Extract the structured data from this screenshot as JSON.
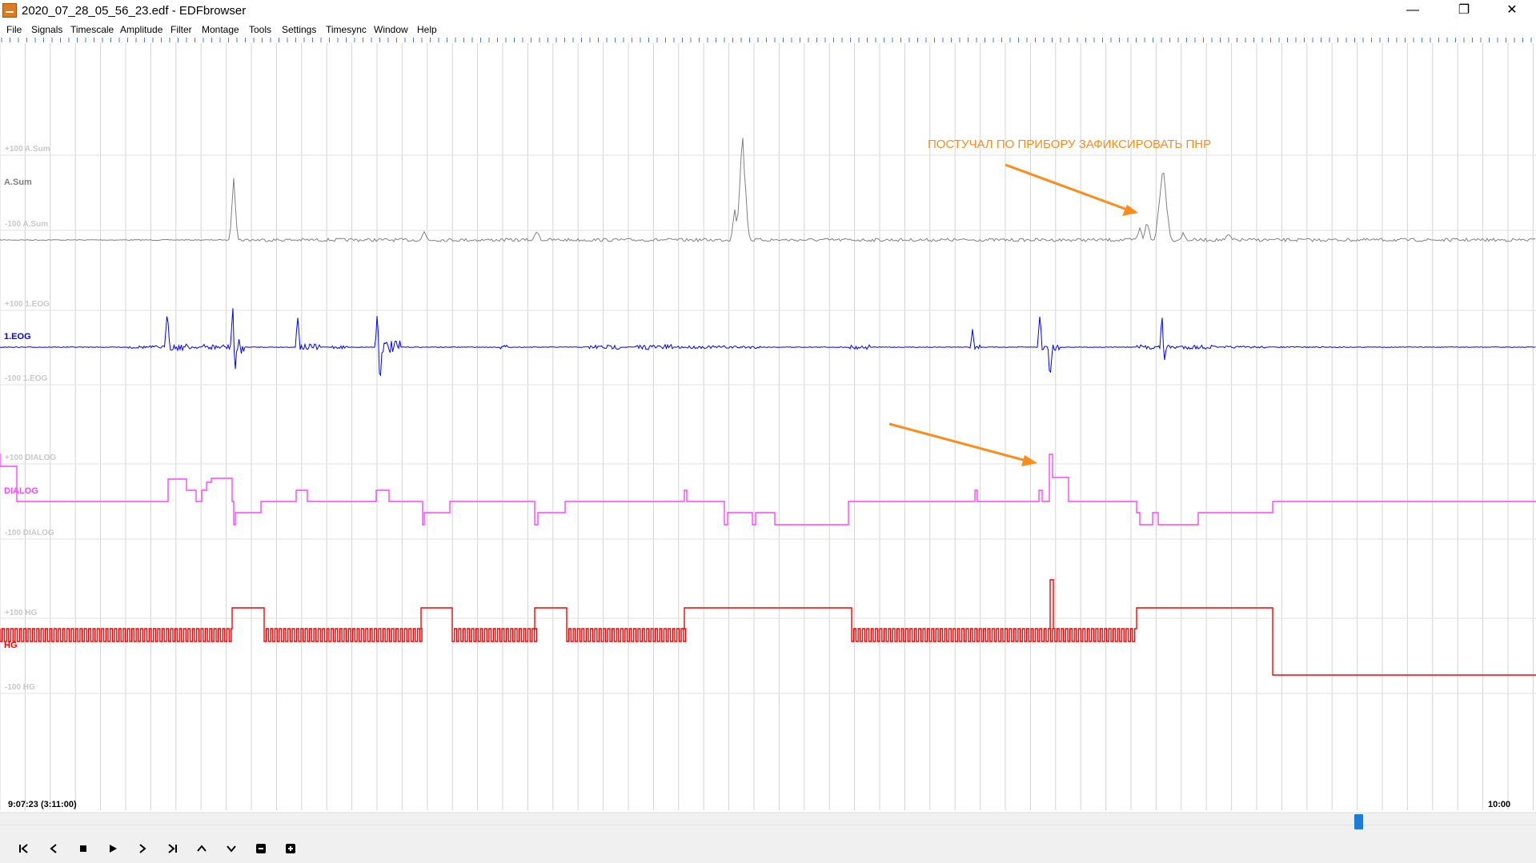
{
  "window": {
    "title": "2020_07_28_05_56_23.edf - EDFbrowser",
    "app_icon": "edf-app-icon"
  },
  "window_controls": {
    "minimize": "—",
    "maximize": "❐",
    "close": "✕"
  },
  "menu": [
    {
      "label": "File"
    },
    {
      "label": "Signals"
    },
    {
      "label": "Timescale"
    },
    {
      "label": "Amplitude"
    },
    {
      "label": "Filter"
    },
    {
      "label": "Montage"
    },
    {
      "label": "Tools"
    },
    {
      "label": "Settings"
    },
    {
      "label": "Timesync"
    },
    {
      "label": "Window"
    },
    {
      "label": "Help"
    }
  ],
  "signals": [
    {
      "label": "A.Sum",
      "upper": "+100 A.Sum",
      "lower": "-100 A.Sum",
      "color": "#808080"
    },
    {
      "label": "1.EOG",
      "upper": "+100 1.EOG",
      "lower": "-100 1.EOG",
      "color": "#0000ff"
    },
    {
      "label": "DIALOG",
      "upper": "+100 DIALOG",
      "lower": "-100 DIALOG",
      "color": "#ff44ff"
    },
    {
      "label": "HG",
      "upper": "+100 HG",
      "lower": "-100 HG",
      "color": "#ff0000"
    }
  ],
  "annotation": {
    "text": "ПОСТУЧАЛ ПО ПРИБОРУ ЗАФИКСИРОВАТЬ ПНР",
    "color": "#ff8c1a"
  },
  "timeline": {
    "start_label": "9:07:23 (3:11:00)",
    "end_label": "10:00",
    "scroll_position": 0.885
  },
  "controls": [
    {
      "name": "skip-to-start",
      "icon": "skip-start-icon"
    },
    {
      "name": "step-back",
      "icon": "chevron-left-icon"
    },
    {
      "name": "stop",
      "icon": "stop-icon"
    },
    {
      "name": "play",
      "icon": "play-icon"
    },
    {
      "name": "step-forward",
      "icon": "chevron-right-icon"
    },
    {
      "name": "skip-to-end",
      "icon": "skip-end-icon"
    },
    {
      "name": "amplitude-up",
      "icon": "chevron-up-icon"
    },
    {
      "name": "amplitude-down",
      "icon": "chevron-down-icon"
    },
    {
      "name": "zoom-out",
      "icon": "minus-box-icon"
    },
    {
      "name": "zoom-in",
      "icon": "plus-box-icon"
    }
  ]
}
